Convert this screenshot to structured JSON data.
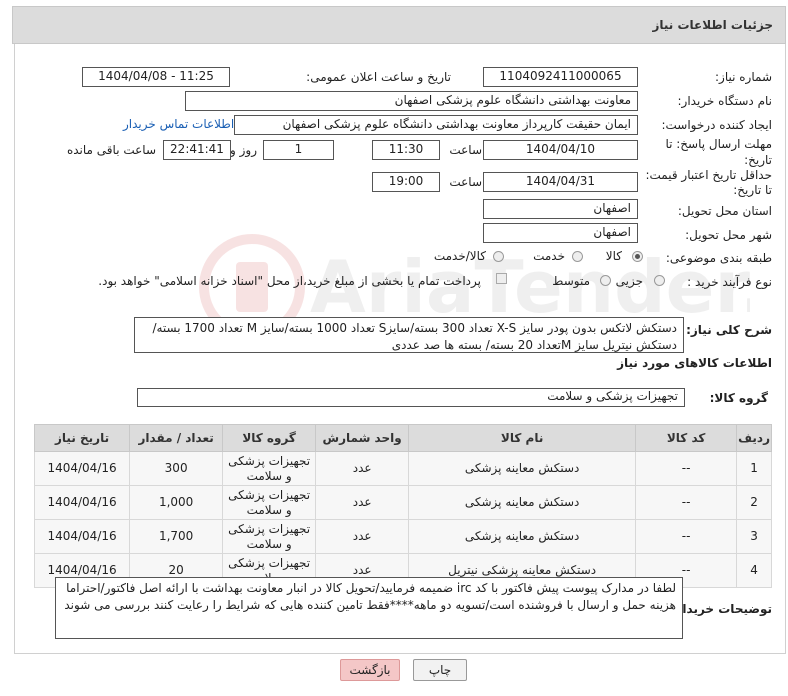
{
  "header": {
    "title": "جزئیات اطلاعات نیاز"
  },
  "form": {
    "need_number_label": "شماره نیاز:",
    "need_number": "1104092411000065",
    "announce_label": "تاریخ و ساعت اعلان عمومی:",
    "announce_value": "1404/04/08 - 11:25",
    "buyer_org_label": "نام دستگاه خریدار:",
    "buyer_org": "معاونت بهداشتی دانشگاه علوم پزشکی اصفهان",
    "requester_label": "ایجاد کننده درخواست:",
    "requester": "ایمان حقیقت کارپرداز معاونت بهداشتی دانشگاه علوم پزشکی اصفهان",
    "buyer_contact_link": "اطلاعات تماس خریدار",
    "deadline_label_1": "مهلت ارسال پاسخ: تا",
    "deadline_label_2": "تاریخ:",
    "deadline_date": "1404/04/10",
    "time_label": "ساعت",
    "deadline_time": "11:30",
    "days_value": "1",
    "days_label": "روز و",
    "remaining_time": "22:41:41",
    "remaining_label": "ساعت باقی مانده",
    "price_validity_label_1": "حداقل تاریخ اعتبار قیمت:",
    "price_validity_label_2": "تا تاریخ:",
    "price_validity_date": "1404/04/31",
    "price_validity_time": "19:00",
    "province_label": "استان محل تحویل:",
    "province": "اصفهان",
    "city_label": "شهر محل تحویل:",
    "city": "اصفهان",
    "category_label": "طبقه بندی موضوعی:",
    "category_options": [
      "کالا",
      "خدمت",
      "کالا/خدمت"
    ],
    "process_label": "نوع فرآیند خرید :",
    "process_options": [
      "جزیی",
      "متوسط"
    ],
    "payment_note": "پرداخت تمام یا بخشی از مبلغ خرید،از محل \"اسناد خزانه اسلامی\" خواهد بود.",
    "general_desc_label": "شرح کلی نیاز:",
    "general_desc": "دستکش لاتکس بدون پودر سایز X-S تعداد 300 بسته/سایزS  تعداد 1000 بسته/سایز M تعداد 1700 بسته/ دستکش نیتریل سایز Mتعداد 20 بسته/ بسته ها صد عددی"
  },
  "goods": {
    "section_title": "اطلاعات کالاهای مورد نیاز",
    "group_label": "گروه کالا:",
    "group_value": "تجهیزات پزشکی و سلامت",
    "columns": [
      "ردیف",
      "کد کالا",
      "نام کالا",
      "واحد شمارش",
      "گروه کالا",
      "تعداد / مقدار",
      "تاریخ نیاز"
    ],
    "rows": [
      {
        "n": "1",
        "code": "--",
        "name": "دستکش معاینه پزشکی",
        "unit": "عدد",
        "group": "تجهیزات پزشکی و سلامت",
        "qty": "300",
        "date": "1404/04/16"
      },
      {
        "n": "2",
        "code": "--",
        "name": "دستکش معاینه پزشکی",
        "unit": "عدد",
        "group": "تجهیزات پزشکی و سلامت",
        "qty": "1,000",
        "date": "1404/04/16"
      },
      {
        "n": "3",
        "code": "--",
        "name": "دستکش معاینه پزشکی",
        "unit": "عدد",
        "group": "تجهیزات پزشکی و سلامت",
        "qty": "1,700",
        "date": "1404/04/16"
      },
      {
        "n": "4",
        "code": "--",
        "name": "دستکش معاینه پزشکی نیتریل",
        "unit": "عدد",
        "group": "تجهیزات پزشکی و سلامت",
        "qty": "20",
        "date": "1404/04/16"
      }
    ]
  },
  "buyer_notes": {
    "label": "توضیحات خریدار:",
    "text": "لطفا در مدارک پیوست پیش فاکتور با کد irc ضمیمه فرمایید/تحویل کالا در انبار معاونت بهداشت با ارائه اصل فاکتور/احتراما هزینه حمل و ارسال با فروشنده است/تسویه دو ماهه****فقط تامین کننده هایی که شرایط را رعایت کنند بررسی می شوند"
  },
  "buttons": {
    "print": "چاپ",
    "back": "بازگشت"
  },
  "watermark": {
    "text": "AriaTender.net"
  }
}
